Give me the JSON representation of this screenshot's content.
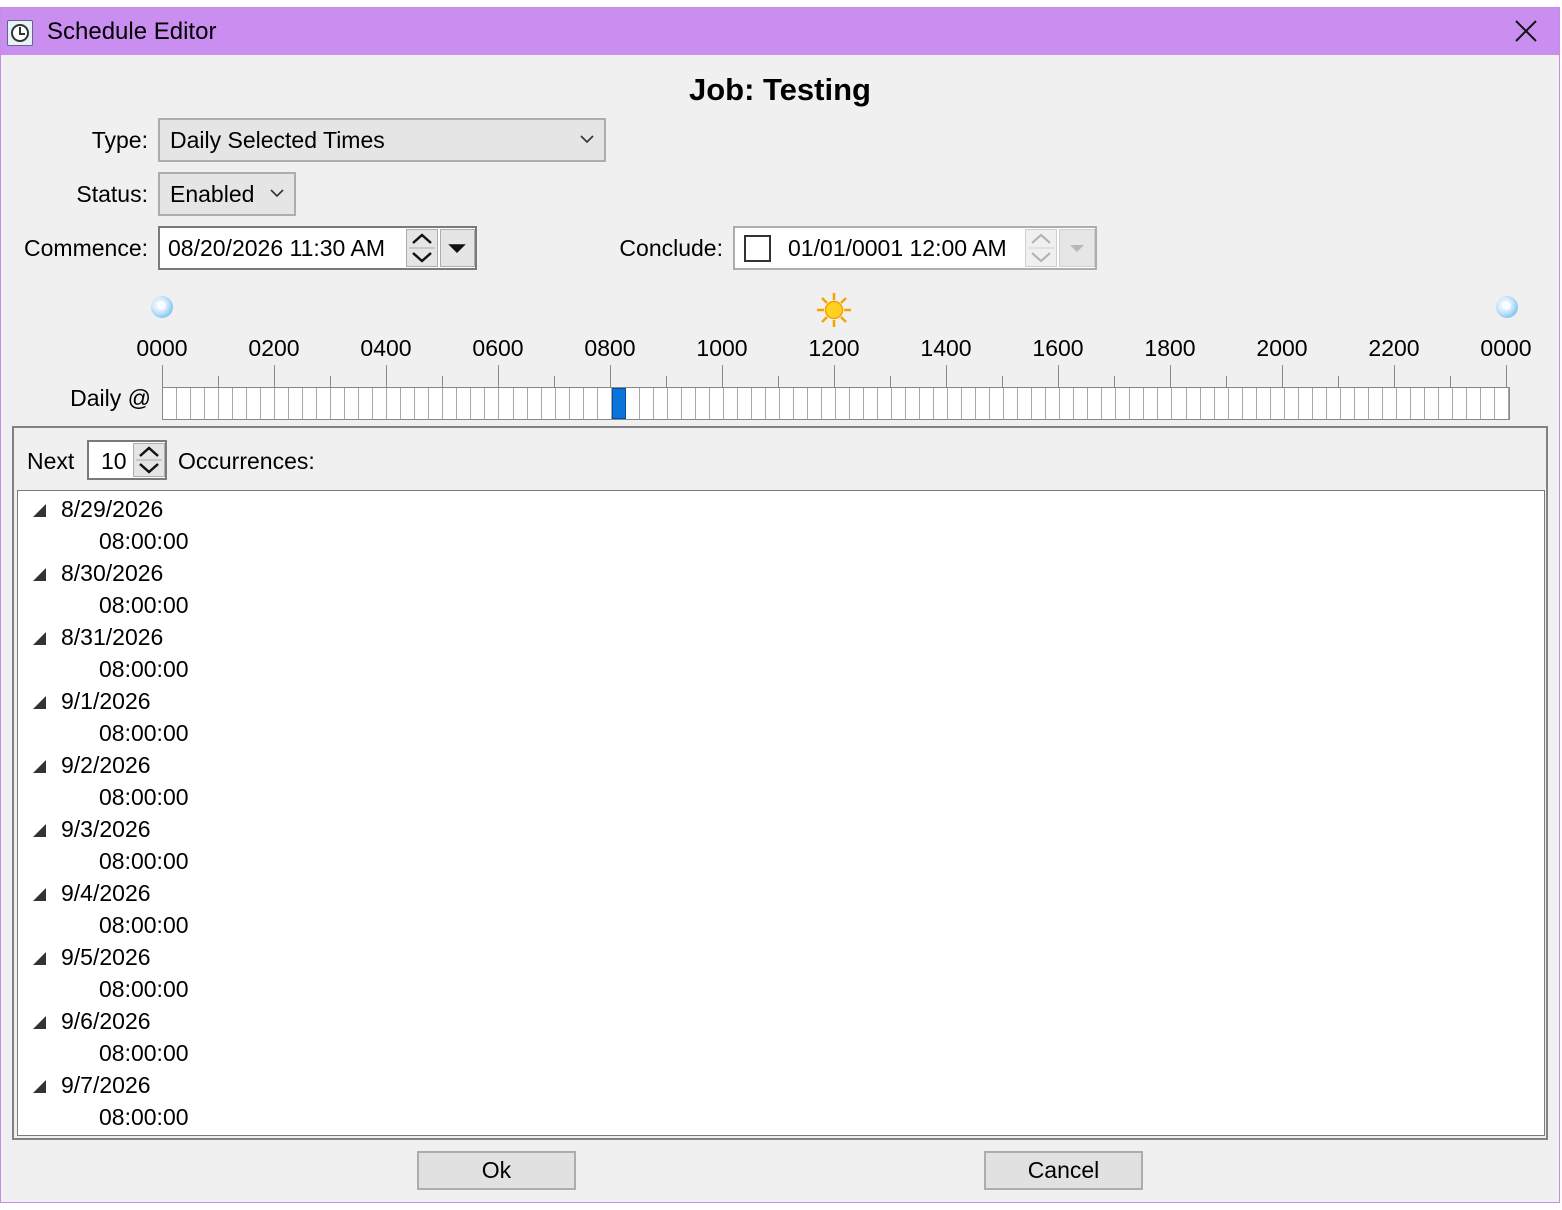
{
  "window": {
    "title": "Schedule Editor",
    "app_icon": "clock-icon",
    "close_icon": "close-icon",
    "titlebar_color": "#c98ef0"
  },
  "job_title": "Job: Testing",
  "type": {
    "label": "Type:",
    "value": "Daily Selected Times"
  },
  "status": {
    "label": "Status:",
    "value": "Enabled"
  },
  "commence": {
    "label": "Commence:",
    "value": "08/20/2026 11:30 AM"
  },
  "conclude": {
    "label": "Conclude:",
    "value": "01/01/0001 12:00 AM",
    "checked": false
  },
  "timeline": {
    "hours": [
      "0000",
      "0200",
      "0400",
      "0600",
      "0800",
      "1000",
      "1200",
      "1400",
      "1600",
      "1800",
      "2000",
      "2200",
      "0000"
    ],
    "icons": [
      "moon-icon",
      "sun-icon",
      "moon-icon"
    ],
    "daily_label": "Daily @",
    "slots_per_day": 96,
    "selected_slots": [
      32
    ],
    "selected_color": "#0a74da"
  },
  "next": {
    "label": "Next",
    "count": "10",
    "suffix": "Occurrences:"
  },
  "occurrences": [
    {
      "date": "8/29/2026",
      "time": "08:00:00"
    },
    {
      "date": "8/30/2026",
      "time": "08:00:00"
    },
    {
      "date": "8/31/2026",
      "time": "08:00:00"
    },
    {
      "date": "9/1/2026",
      "time": "08:00:00"
    },
    {
      "date": "9/2/2026",
      "time": "08:00:00"
    },
    {
      "date": "9/3/2026",
      "time": "08:00:00"
    },
    {
      "date": "9/4/2026",
      "time": "08:00:00"
    },
    {
      "date": "9/5/2026",
      "time": "08:00:00"
    },
    {
      "date": "9/6/2026",
      "time": "08:00:00"
    },
    {
      "date": "9/7/2026",
      "time": "08:00:00"
    }
  ],
  "buttons": {
    "ok": "Ok",
    "cancel": "Cancel"
  }
}
